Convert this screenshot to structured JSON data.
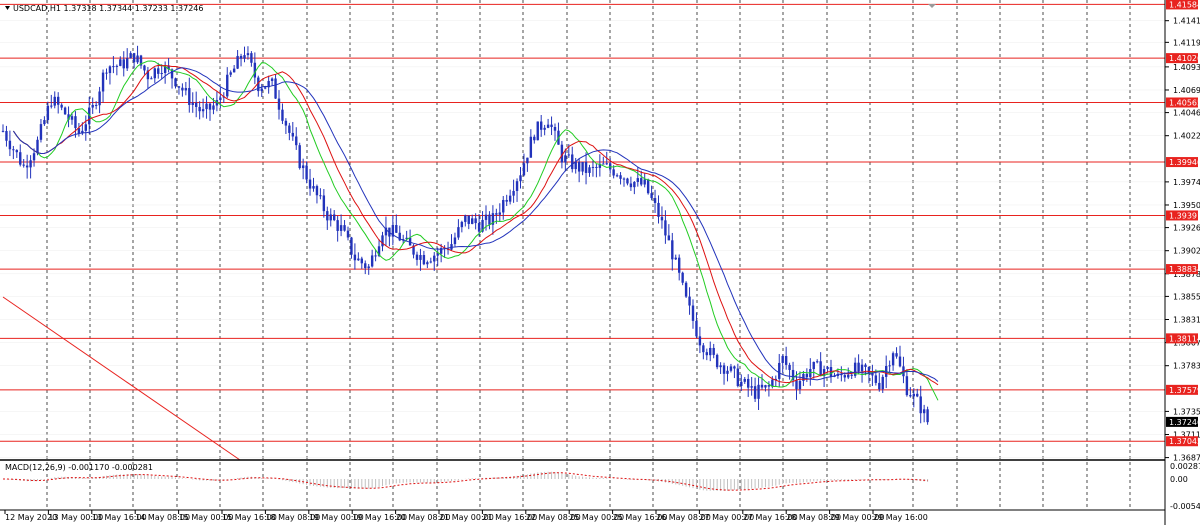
{
  "window": {
    "symbol_info": "USDCAD,H1  1.37318 1.37344 1.37233 1.37246",
    "macd_info": "MACD(12,26,9) -0.001170 -0.000281"
  },
  "price_axis": {
    "ticks": [
      "1.41415",
      "1.41190",
      "1.40935",
      "1.40695",
      "1.40460",
      "1.40220",
      "1.39740",
      "1.39500",
      "1.39265",
      "1.39025",
      "1.38785",
      "1.38550",
      "1.38310",
      "1.38070",
      "1.37830",
      "1.37355",
      "1.37115",
      "1.36875"
    ],
    "tick_values": [
      1.41415,
      1.4119,
      1.40935,
      1.40695,
      1.4046,
      1.4022,
      1.3974,
      1.395,
      1.39265,
      1.39025,
      1.38785,
      1.3855,
      1.3831,
      1.3807,
      1.3783,
      1.37355,
      1.37115,
      1.36875
    ],
    "range": [
      1.3685,
      1.4163
    ],
    "current_price": "1.37246",
    "current_value": 1.37246
  },
  "macd_axis": {
    "ticks": [
      "0.002876",
      "0.00",
      "-0.005433"
    ]
  },
  "time_axis": {
    "labels": [
      "12 May 2020",
      "13 May 00:00",
      "13 May 16:00",
      "14 May 08:00",
      "15 May 00:00",
      "15 May 16:00",
      "18 May 08:00",
      "19 May 00:00",
      "19 May 16:00",
      "20 May 08:00",
      "21 May 00:00",
      "21 May 16:00",
      "22 May 08:00",
      "25 May 00:00",
      "25 May 16:00",
      "26 May 08:00",
      "27 May 00:00",
      "27 May 16:00",
      "28 May 08:00",
      "29 May 00:00",
      "29 May 16:00"
    ]
  },
  "levels": [
    {
      "label": "1.41584",
      "value": 1.41584
    },
    {
      "label": "1.41026",
      "value": 1.41026
    },
    {
      "label": "1.40565",
      "value": 1.40565
    },
    {
      "label": "1.39946",
      "value": 1.39946
    },
    {
      "label": "1.39391",
      "value": 1.39391
    },
    {
      "label": "1.38834",
      "value": 1.38834
    },
    {
      "label": "1.38114",
      "value": 1.38114
    },
    {
      "label": "1.37579",
      "value": 1.37579
    },
    {
      "label": "1.37045",
      "value": 1.37045
    }
  ],
  "colors": {
    "candles": "#2233bb",
    "level_line": "#e8231f",
    "level_label_bg": "#e8231f",
    "ma_fast": "#22cc22",
    "ma_mid": "#dd1111",
    "ma_slow": "#2233bb",
    "grid": "#000000",
    "macd_hist": "#c0c0c0",
    "macd_signal": "#dd1111"
  },
  "chart_data": {
    "type": "candlestick",
    "symbol": "USDCAD",
    "timeframe": "H1",
    "close_path": [
      [
        0,
        1.4027
      ],
      [
        6,
        1.399
      ],
      [
        10,
        1.4015
      ],
      [
        14,
        1.406
      ],
      [
        18,
        1.4045
      ],
      [
        22,
        1.4025
      ],
      [
        26,
        1.405
      ],
      [
        30,
        1.4095
      ],
      [
        34,
        1.4095
      ],
      [
        38,
        1.4105
      ],
      [
        42,
        1.4085
      ],
      [
        46,
        1.4095
      ],
      [
        50,
        1.408
      ],
      [
        54,
        1.406
      ],
      [
        58,
        1.4045
      ],
      [
        62,
        1.4055
      ],
      [
        66,
        1.4085
      ],
      [
        70,
        1.411
      ],
      [
        74,
        1.4075
      ],
      [
        78,
        1.4075
      ],
      [
        82,
        1.4035
      ],
      [
        86,
        1.3995
      ],
      [
        90,
        1.3965
      ],
      [
        94,
        1.394
      ],
      [
        98,
        1.3925
      ],
      [
        102,
        1.3895
      ],
      [
        106,
        1.3885
      ],
      [
        110,
        1.3925
      ],
      [
        114,
        1.392
      ],
      [
        118,
        1.3905
      ],
      [
        122,
        1.3895
      ],
      [
        126,
        1.39
      ],
      [
        130,
        1.391
      ],
      [
        134,
        1.3935
      ],
      [
        138,
        1.393
      ],
      [
        142,
        1.3935
      ],
      [
        146,
        1.396
      ],
      [
        150,
        1.3985
      ],
      [
        154,
        1.4025
      ],
      [
        158,
        1.404
      ],
      [
        162,
        1.4
      ],
      [
        166,
        1.399
      ],
      [
        170,
        1.3985
      ],
      [
        174,
        1.399
      ],
      [
        178,
        1.3985
      ],
      [
        182,
        1.3975
      ],
      [
        186,
        1.397
      ],
      [
        190,
        1.394
      ],
      [
        194,
        1.39
      ],
      [
        198,
        1.385
      ],
      [
        202,
        1.381
      ],
      [
        206,
        1.379
      ],
      [
        210,
        1.378
      ],
      [
        214,
        1.3765
      ],
      [
        218,
        1.3755
      ],
      [
        222,
        1.376
      ],
      [
        226,
        1.379
      ],
      [
        230,
        1.3765
      ],
      [
        234,
        1.378
      ],
      [
        238,
        1.378
      ],
      [
        242,
        1.377
      ],
      [
        246,
        1.378
      ],
      [
        250,
        1.3775
      ],
      [
        254,
        1.3765
      ],
      [
        258,
        1.38
      ],
      [
        262,
        1.376
      ],
      [
        266,
        1.374
      ],
      [
        268,
        1.3725
      ]
    ],
    "ylim": [
      1.3685,
      1.4163
    ],
    "horizontal_levels": [
      1.41584,
      1.41026,
      1.40565,
      1.39946,
      1.39391,
      1.38834,
      1.38114,
      1.37579,
      1.37045
    ]
  }
}
